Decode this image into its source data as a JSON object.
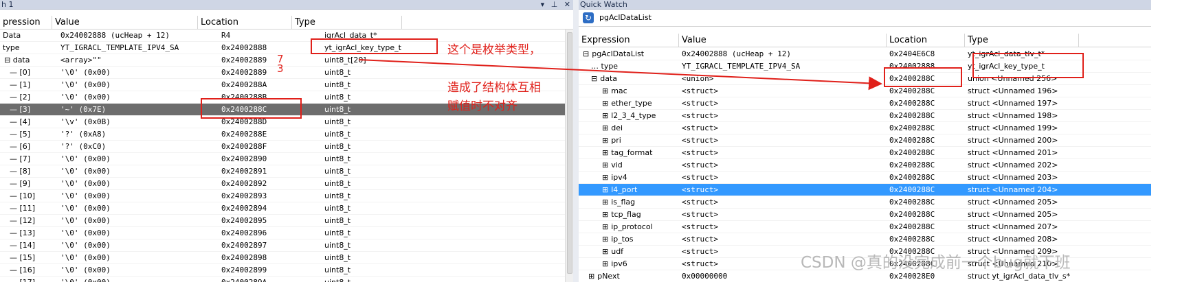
{
  "watch": {
    "title": "h 1",
    "headers": {
      "expression": "pression",
      "value": "Value",
      "location": "Location",
      "type": "Type"
    },
    "rows": [
      {
        "expr": "Data",
        "value": "0x24002888 (ucHeap + 12)",
        "location": "R4",
        "type": "igrAcl_data_t*"
      },
      {
        "expr": "type",
        "value": "YT_IGRACL_TEMPLATE_IPV4_SA",
        "location": "0x24002888",
        "type": "yt_igrAcl_key_type_t"
      },
      {
        "expr": "data",
        "value": "<array>\"\"",
        "location": "0x24002889",
        "type": "uint8_t[20]"
      },
      {
        "expr": "[0]",
        "value": "'\\0' (0x00)",
        "location": "0x24002889",
        "type": "uint8_t"
      },
      {
        "expr": "[1]",
        "value": "'\\0' (0x00)",
        "location": "0x2400288A",
        "type": "uint8_t"
      },
      {
        "expr": "[2]",
        "value": "'\\0' (0x00)",
        "location": "0x2400288B",
        "type": "uint8_t"
      },
      {
        "expr": "[3]",
        "value": "'~' (0x7E)",
        "location": "0x2400288C",
        "type": "uint8_t"
      },
      {
        "expr": "[4]",
        "value": "'\\v' (0x0B)",
        "location": "0x2400288D",
        "type": "uint8_t"
      },
      {
        "expr": "[5]",
        "value": "'?' (0xA8)",
        "location": "0x2400288E",
        "type": "uint8_t"
      },
      {
        "expr": "[6]",
        "value": "'?' (0xC0)",
        "location": "0x2400288F",
        "type": "uint8_t"
      },
      {
        "expr": "[7]",
        "value": "'\\0' (0x00)",
        "location": "0x24002890",
        "type": "uint8_t"
      },
      {
        "expr": "[8]",
        "value": "'\\0' (0x00)",
        "location": "0x24002891",
        "type": "uint8_t"
      },
      {
        "expr": "[9]",
        "value": "'\\0' (0x00)",
        "location": "0x24002892",
        "type": "uint8_t"
      },
      {
        "expr": "[10]",
        "value": "'\\0' (0x00)",
        "location": "0x24002893",
        "type": "uint8_t"
      },
      {
        "expr": "[11]",
        "value": "'\\0' (0x00)",
        "location": "0x24002894",
        "type": "uint8_t"
      },
      {
        "expr": "[12]",
        "value": "'\\0' (0x00)",
        "location": "0x24002895",
        "type": "uint8_t"
      },
      {
        "expr": "[13]",
        "value": "'\\0' (0x00)",
        "location": "0x24002896",
        "type": "uint8_t"
      },
      {
        "expr": "[14]",
        "value": "'\\0' (0x00)",
        "location": "0x24002897",
        "type": "uint8_t"
      },
      {
        "expr": "[15]",
        "value": "'\\0' (0x00)",
        "location": "0x24002898",
        "type": "uint8_t"
      },
      {
        "expr": "[16]",
        "value": "'\\0' (0x00)",
        "location": "0x24002899",
        "type": "uint8_t"
      },
      {
        "expr": "[17]",
        "value": "'\\0' (0x00)",
        "location": "0x2400289A",
        "type": "uint8_t"
      }
    ]
  },
  "annotations": {
    "handwritten": "7\n3",
    "enum_note": "这个是枚举类型，",
    "align_note_1": "造成了结构体互相",
    "align_note_2": "赋值时不对齐"
  },
  "quick": {
    "title": "Quick Watch",
    "expression_value": "pgAclDataList",
    "headers": {
      "expression": "Expression",
      "value": "Value",
      "location": "Location",
      "type": "Type"
    },
    "rows": [
      {
        "expr": "pgAclDataList",
        "value": "0x24002888 (ucHeap + 12)",
        "location": "0x2404E6C8",
        "type": "yt_igrAcl_data_tlv_t*"
      },
      {
        "expr": "type",
        "value": "YT_IGRACL_TEMPLATE_IPV4_SA",
        "location": "0x24002888",
        "type": "yt_igrAcl_key_type_t"
      },
      {
        "expr": "data",
        "value": "<union>",
        "location": "0x2400288C",
        "type": "union <Unnamed 256>"
      },
      {
        "expr": "mac",
        "value": "<struct>",
        "location": "0x2400288C",
        "type": "struct <Unnamed 196>"
      },
      {
        "expr": "ether_type",
        "value": "<struct>",
        "location": "0x2400288C",
        "type": "struct <Unnamed 197>"
      },
      {
        "expr": "l2_3_4_type",
        "value": "<struct>",
        "location": "0x2400288C",
        "type": "struct <Unnamed 198>"
      },
      {
        "expr": "dei",
        "value": "<struct>",
        "location": "0x2400288C",
        "type": "struct <Unnamed 199>"
      },
      {
        "expr": "pri",
        "value": "<struct>",
        "location": "0x2400288C",
        "type": "struct <Unnamed 200>"
      },
      {
        "expr": "tag_format",
        "value": "<struct>",
        "location": "0x2400288C",
        "type": "struct <Unnamed 201>"
      },
      {
        "expr": "vid",
        "value": "<struct>",
        "location": "0x2400288C",
        "type": "struct <Unnamed 202>"
      },
      {
        "expr": "ipv4",
        "value": "<struct>",
        "location": "0x2400288C",
        "type": "struct <Unnamed 203>"
      },
      {
        "expr": "l4_port",
        "value": "<struct>",
        "location": "0x2400288C",
        "type": "struct <Unnamed 204>"
      },
      {
        "expr": "is_flag",
        "value": "<struct>",
        "location": "0x2400288C",
        "type": "struct <Unnamed 205>"
      },
      {
        "expr": "tcp_flag",
        "value": "<struct>",
        "location": "0x2400288C",
        "type": "struct <Unnamed 205>"
      },
      {
        "expr": "ip_protocol",
        "value": "<struct>",
        "location": "0x2400288C",
        "type": "struct <Unnamed 207>"
      },
      {
        "expr": "ip_tos",
        "value": "<struct>",
        "location": "0x2400288C",
        "type": "struct <Unnamed 208>"
      },
      {
        "expr": "udf",
        "value": "<struct>",
        "location": "0x2400288C",
        "type": "struct <Unnamed 209>"
      },
      {
        "expr": "ipv6",
        "value": "<struct>",
        "location": "0x2400288C",
        "type": "struct <Unnamed 210>"
      },
      {
        "expr": "pNext",
        "value": "0x00000000",
        "location": "0x240028E0",
        "type": "struct yt_igrAcl_data_tlv_s*"
      }
    ]
  },
  "watermark": "CSDN @真的没完成前一个bug就下班",
  "colors": {
    "annotation_red": "#e0201a",
    "selection_blue": "#3399ff",
    "selection_gray": "#6d6d6d"
  }
}
